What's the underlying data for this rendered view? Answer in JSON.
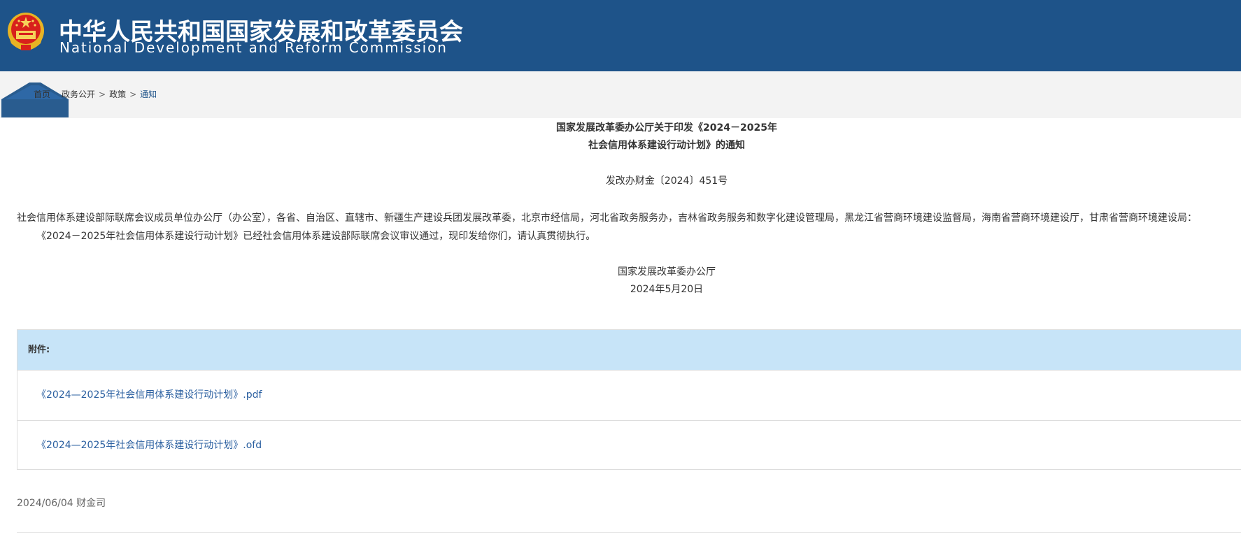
{
  "header": {
    "title_cn": "中华人民共和国国家发展和改革委员会",
    "title_en": "National Development and Reform Commission"
  },
  "breadcrumb": {
    "home": "首页",
    "items": [
      "政务公开",
      "政策",
      "通知"
    ],
    "separator": ">"
  },
  "document": {
    "title_line1": "国家发展改革委办公厅关于印发《2024－2025年",
    "title_line2": "社会信用体系建设行动计划》的通知",
    "doc_number": "发改办财金〔2024〕451号",
    "addressees": "社会信用体系建设部际联席会议成员单位办公厅（办公室），各省、自治区、直辖市、新疆生产建设兵团发展改革委，北京市经信局，河北省政务服务办，吉林省政务服务和数字化建设管理局，黑龙江省营商环境建设监督局，海南省营商环境建设厅，甘肃省营商环境建设局：",
    "body": "《2024－2025年社会信用体系建设行动计划》已经社会信用体系建设部际联席会议审议通过，现印发给你们，请认真贯彻执行。",
    "signer": "国家发展改革委办公厅",
    "date": "2024年5月20日"
  },
  "attachments": {
    "label": "附件:",
    "files": [
      "《2024—2025年社会信用体系建设行动计划》.pdf",
      "《2024—2025年社会信用体系建设行动计划》.ofd"
    ]
  },
  "meta": {
    "publish": "2024/06/04 财金司"
  },
  "colors": {
    "header_bg": "#1e5389",
    "attach_head_bg": "#c7e4f8",
    "link": "#2a5fa0"
  }
}
